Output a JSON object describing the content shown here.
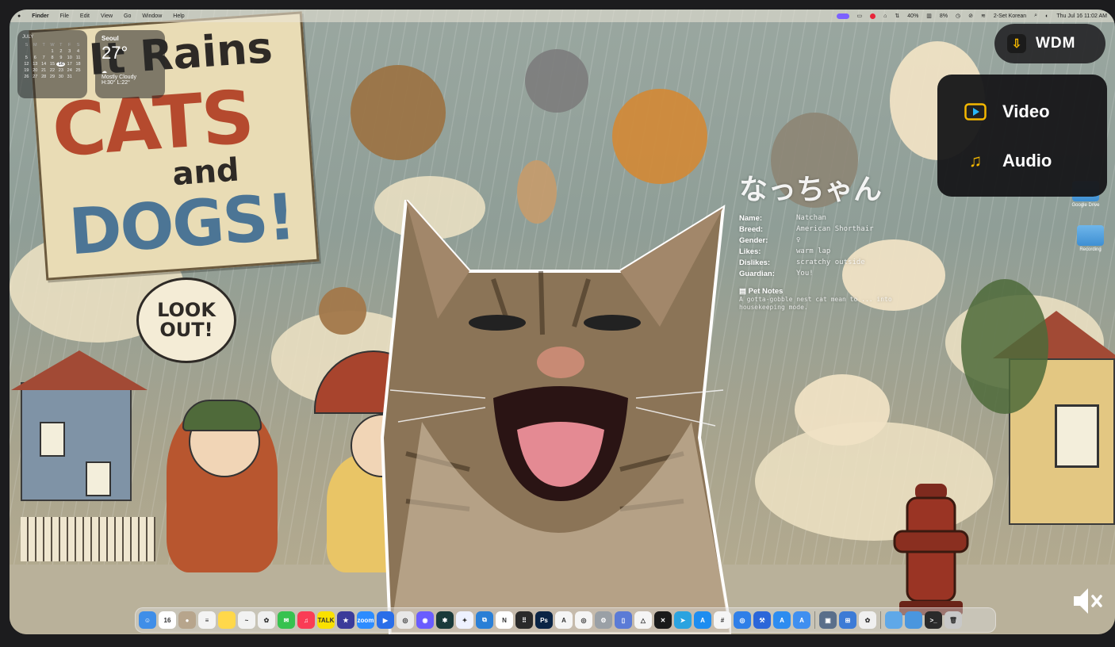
{
  "menubar": {
    "app_name": "Finder",
    "items": [
      "File",
      "Edit",
      "View",
      "Go",
      "Window",
      "Help"
    ],
    "status": {
      "battery_percent": "40%",
      "cpu_percent": "8%",
      "input_source": "2-Set Korean",
      "clock": "Thu Jul 16  11:02 AM"
    }
  },
  "calendar_widget": {
    "month": "JULY",
    "weekday_headers": [
      "S",
      "M",
      "T",
      "W",
      "T",
      "F",
      "S"
    ],
    "days": [
      "",
      "",
      "",
      "1",
      "2",
      "3",
      "4",
      "5",
      "6",
      "7",
      "8",
      "9",
      "10",
      "11",
      "12",
      "13",
      "14",
      "15",
      "16",
      "17",
      "18",
      "19",
      "20",
      "21",
      "22",
      "23",
      "24",
      "25",
      "26",
      "27",
      "28",
      "29",
      "30",
      "31",
      ""
    ],
    "today": "16"
  },
  "weather_widget": {
    "city": "Seoul",
    "temperature": "27°",
    "condition": "Mostly Cloudy",
    "high_low": "H:30° L:22°"
  },
  "wallpaper": {
    "poster_line1": "It Rains",
    "poster_line2": "CATS",
    "poster_line3": "and",
    "poster_line4": "DOGS!",
    "bubble_line1": "LOOK",
    "bubble_line2": "OUT!"
  },
  "pet_profile": {
    "title": "なっちゃん",
    "fields": [
      {
        "key": "Name:",
        "value": "Natchan"
      },
      {
        "key": "Breed:",
        "value": "American Shorthair"
      },
      {
        "key": "Gender:",
        "value": "♀"
      },
      {
        "key": "Likes:",
        "value": "warm lap"
      },
      {
        "key": "Dislikes:",
        "value": "scratchy outside"
      },
      {
        "key": "Guardian:",
        "value": "You!"
      }
    ],
    "notes_heading": "Pet Notes",
    "notes_text": "A gotta-gobble nest cat mean to ... into housekeeping mode."
  },
  "wdm": {
    "label": "WDM",
    "menu": [
      {
        "label": "Video",
        "icon": "video-play-icon",
        "color": "#f5b800"
      },
      {
        "label": "Audio",
        "icon": "music-note-icon",
        "color": "#f5b800"
      }
    ]
  },
  "desktop_icons": [
    {
      "label": "Google Drive"
    },
    {
      "label": "Recording"
    }
  ],
  "dock": {
    "apps": [
      {
        "name": "finder-icon",
        "color": "#3f8ee8",
        "glyph": "☺"
      },
      {
        "name": "calendar-icon",
        "color": "#ffffff",
        "glyph": "16"
      },
      {
        "name": "contacts-icon",
        "color": "#b7a58c",
        "glyph": "●"
      },
      {
        "name": "reminders-icon",
        "color": "#f3f3f3",
        "glyph": "≡"
      },
      {
        "name": "notes-icon",
        "color": "#ffd84a",
        "glyph": ""
      },
      {
        "name": "freeform-icon",
        "color": "#f2f2f2",
        "glyph": "~"
      },
      {
        "name": "photos-icon",
        "color": "#f0f0f0",
        "glyph": "✿"
      },
      {
        "name": "messages-icon",
        "color": "#36c24f",
        "glyph": "✉"
      },
      {
        "name": "music-icon",
        "color": "#fa3c55",
        "glyph": "♫"
      },
      {
        "name": "kakaotalk-icon",
        "color": "#fae100",
        "glyph": "TALK"
      },
      {
        "name": "vpn-icon",
        "color": "#3b3b9a",
        "glyph": "★"
      },
      {
        "name": "zoom-icon",
        "color": "#2d8cff",
        "glyph": "zoom"
      },
      {
        "name": "keynote-icon",
        "color": "#2a6ee8",
        "glyph": "▶"
      },
      {
        "name": "chrome-icon",
        "color": "#e8e8e8",
        "glyph": "◎"
      },
      {
        "name": "ai-assistant-icon",
        "color": "#6a5cff",
        "glyph": "◉"
      },
      {
        "name": "perplexity-icon",
        "color": "#1a3a3a",
        "glyph": "✱"
      },
      {
        "name": "gemini-icon",
        "color": "#eef2ff",
        "glyph": "✦"
      },
      {
        "name": "vscode-icon",
        "color": "#2a7fd6",
        "glyph": "⧉"
      },
      {
        "name": "notion-icon",
        "color": "#ffffff",
        "glyph": "N"
      },
      {
        "name": "calculator-icon",
        "color": "#2a2a2a",
        "glyph": "⠿"
      },
      {
        "name": "photoshop-icon",
        "color": "#0a2445",
        "glyph": "Ps"
      },
      {
        "name": "acrobat-icon",
        "color": "#f5f5f5",
        "glyph": "A"
      },
      {
        "name": "chatgpt-icon",
        "color": "#f5f5f5",
        "glyph": "◎"
      },
      {
        "name": "settings-icon",
        "color": "#9aa0a6",
        "glyph": "⚙"
      },
      {
        "name": "phone-mirror-icon",
        "color": "#5b7bd6",
        "glyph": "▯"
      },
      {
        "name": "google-drive-icon",
        "color": "#f5f5f5",
        "glyph": "△"
      },
      {
        "name": "capcut-icon",
        "color": "#1a1a1a",
        "glyph": "✕"
      },
      {
        "name": "telegram-icon",
        "color": "#2aa3e0",
        "glyph": "➤"
      },
      {
        "name": "app-store-icon",
        "color": "#1e8df0",
        "glyph": "A"
      },
      {
        "name": "slack-icon",
        "color": "#f5f5f5",
        "glyph": "#"
      },
      {
        "name": "safari-icon",
        "color": "#2f7fe8",
        "glyph": "◎"
      },
      {
        "name": "xcode-icon",
        "color": "#2b66d9",
        "glyph": "⚒"
      },
      {
        "name": "developer-icon",
        "color": "#2d8cf0",
        "glyph": "A"
      },
      {
        "name": "testflight-icon",
        "color": "#3f8ff0",
        "glyph": "A"
      },
      {
        "name": "finder-2-icon",
        "color": "#5a6f8a",
        "glyph": "▣"
      },
      {
        "name": "windows-app-icon",
        "color": "#3c7bd6",
        "glyph": "⊞"
      },
      {
        "name": "photo-grid-icon",
        "color": "#f0f0f0",
        "glyph": "✿"
      },
      {
        "name": "downloads-folder-icon",
        "color": "#5fa8e8",
        "glyph": ""
      },
      {
        "name": "documents-folder-icon",
        "color": "#4a96de",
        "glyph": ""
      },
      {
        "name": "terminal-icon",
        "color": "#2a2a2a",
        "glyph": ">_"
      },
      {
        "name": "trash-icon",
        "color": "#c8c8c8",
        "glyph": "🗑"
      }
    ]
  }
}
